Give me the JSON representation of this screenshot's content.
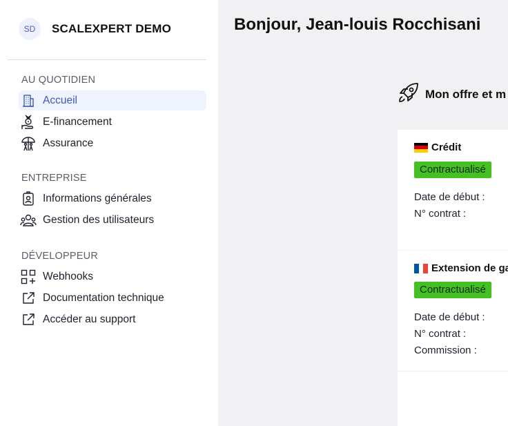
{
  "brand": {
    "initials": "SD",
    "name": "SCALEXPERT DEMO"
  },
  "sidebar": {
    "sections": [
      {
        "title": "AU QUOTIDIEN",
        "items": [
          {
            "label": "Accueil",
            "icon": "building-icon",
            "active": true
          },
          {
            "label": "E-financement",
            "icon": "money-hand-icon"
          },
          {
            "label": "Assurance",
            "icon": "umbrella-family-icon"
          }
        ]
      },
      {
        "title": "ENTREPRISE",
        "items": [
          {
            "label": "Informations générales",
            "icon": "id-badge-icon"
          },
          {
            "label": "Gestion des utilisateurs",
            "icon": "users-icon"
          }
        ]
      },
      {
        "title": "DÉVELOPPEUR",
        "items": [
          {
            "label": "Webhooks",
            "icon": "grid-plus-icon"
          },
          {
            "label": "Documentation technique",
            "icon": "external-link-icon"
          },
          {
            "label": "Accéder au support",
            "icon": "external-link-icon"
          }
        ]
      }
    ]
  },
  "main": {
    "greeting": "Bonjour, Jean-louis Rocchisani",
    "offer_title": "Mon offre et m",
    "cards": [
      {
        "flag": "de",
        "title": "Crédit",
        "status": "Contractualisé",
        "fields": [
          "Date de début :",
          "N° contrat :"
        ]
      },
      {
        "flag": "fr",
        "title": "Extension de ga",
        "status": "Contractualisé",
        "fields": [
          "Date de début :",
          "N° contrat :",
          "Commission :"
        ]
      }
    ]
  },
  "colors": {
    "accent": "#3d5ab8",
    "active_bg": "#eff3fd",
    "badge": "#44c024",
    "main_bg": "#f1f1f4"
  }
}
